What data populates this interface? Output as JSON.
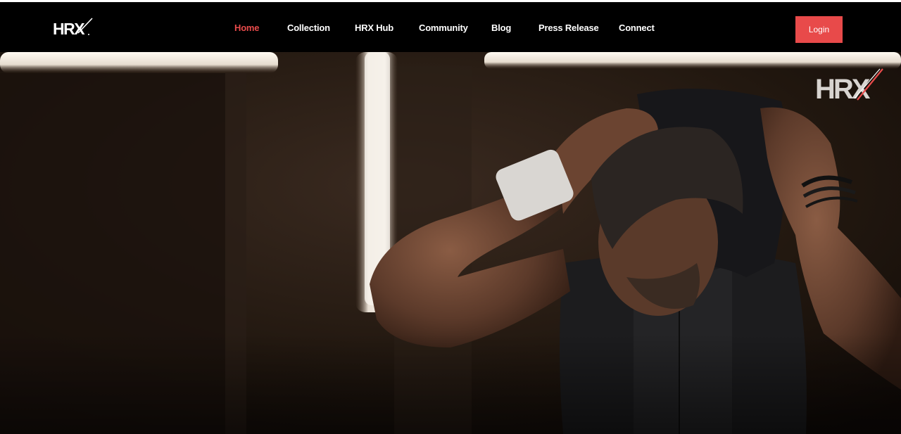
{
  "brand": {
    "logo_text": "HRX",
    "watermark_text": "HRX",
    "accent_color": "#e84b4b"
  },
  "nav": {
    "items": [
      {
        "label": "Home",
        "active": true
      },
      {
        "label": "Collection",
        "active": false
      },
      {
        "label": "HRX Hub",
        "active": false
      },
      {
        "label": "Community",
        "active": false
      },
      {
        "label": "Blog",
        "active": false
      },
      {
        "label": "Press Release",
        "active": false
      },
      {
        "label": "Connect",
        "active": false
      }
    ],
    "login_label": "Login"
  },
  "hero": {
    "description_icon": "fitness-hero-image"
  }
}
